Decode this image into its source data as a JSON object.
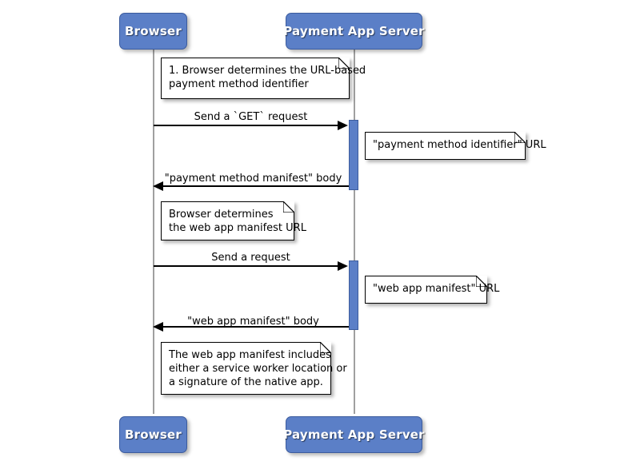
{
  "diagram": {
    "type": "sequence-diagram",
    "title": "Payment method manifest and web app manifest retrieval",
    "colors": {
      "participant_fill": "#5B7FC7",
      "participant_border": "#3C5C9E",
      "participant_text": "#FFFFFF",
      "activation_fill": "#5B7FC7",
      "lifeline": "#A0A0A0",
      "note_fill": "#FFFFFF",
      "note_border": "#000000",
      "message_line": "#000000",
      "background": "#FFFFFF"
    }
  },
  "participants": [
    {
      "id": "browser",
      "label": "Browser"
    },
    {
      "id": "server",
      "label": "Payment App Server"
    }
  ],
  "participants_bottom": [
    {
      "id": "browser",
      "label": "Browser"
    },
    {
      "id": "server",
      "label": "Payment App Server"
    }
  ],
  "notes": [
    {
      "id": "note-1",
      "lines": "1. Browser determines the URL-based\npayment method identifier",
      "attached_to": "browser",
      "position": "over"
    },
    {
      "id": "note-2",
      "lines": "\"payment method identifier\" URL",
      "attached_to": "server",
      "position": "right"
    },
    {
      "id": "note-3",
      "lines": "Browser determines\nthe web app manifest URL",
      "attached_to": "browser",
      "position": "right"
    },
    {
      "id": "note-4",
      "lines": "\"web app manifest\" URL",
      "attached_to": "server",
      "position": "right"
    },
    {
      "id": "note-5",
      "lines": "The web app manifest includes\neither a service worker location or\na signature of the native app.",
      "attached_to": "browser",
      "position": "right"
    }
  ],
  "messages": [
    {
      "id": "msg-1",
      "label": "Send a `GET` request",
      "from": "browser",
      "to": "server",
      "direction": "right"
    },
    {
      "id": "msg-2",
      "label": "\"payment method manifest\" body",
      "from": "server",
      "to": "browser",
      "direction": "left"
    },
    {
      "id": "msg-3",
      "label": "Send a request",
      "from": "browser",
      "to": "server",
      "direction": "right"
    },
    {
      "id": "msg-4",
      "label": "\"web app manifest\" body",
      "from": "server",
      "to": "browser",
      "direction": "left"
    }
  ],
  "activations": [
    {
      "id": "activation-1",
      "on": "server"
    },
    {
      "id": "activation-2",
      "on": "server"
    }
  ]
}
